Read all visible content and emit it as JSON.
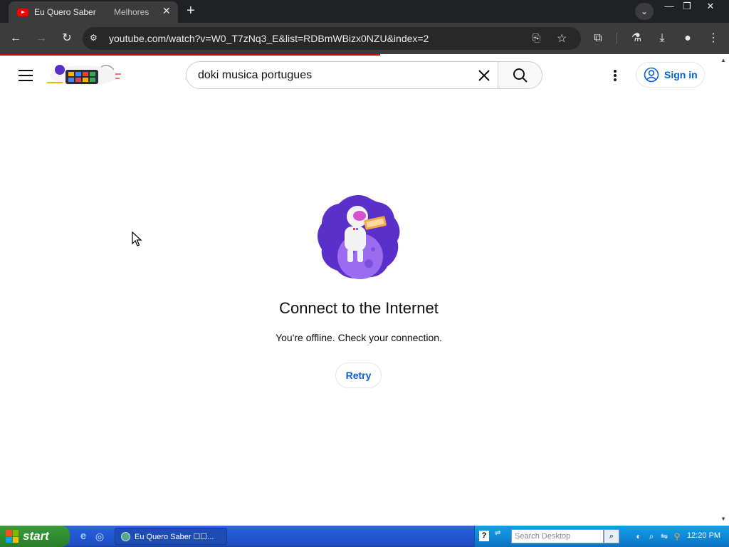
{
  "browser": {
    "tabs": [
      {
        "title": "Eu Quero Saber",
        "active": true
      },
      {
        "title": "Melhores",
        "active": false
      }
    ],
    "new_tab_symbol": "+",
    "url": "youtube.com/watch?v=W0_T7zNq3_E&list=RDBmWBizx0NZU&index=2",
    "window_controls": [
      "minimize-icon",
      "restore-icon",
      "close-icon"
    ]
  },
  "youtube": {
    "search_query": "doki musica portugues",
    "sign_in_label": "Sign in",
    "offline": {
      "title": "Connect to the Internet",
      "message": "You're offline. Check your connection.",
      "retry_label": "Retry"
    },
    "accent_color": "#065fd4"
  },
  "taskbar": {
    "start_label": "start",
    "task_button_label": "Eu Quero Saber ☐☐...",
    "desktop_search_placeholder": "Search Desktop",
    "clock": "12:20 PM"
  }
}
